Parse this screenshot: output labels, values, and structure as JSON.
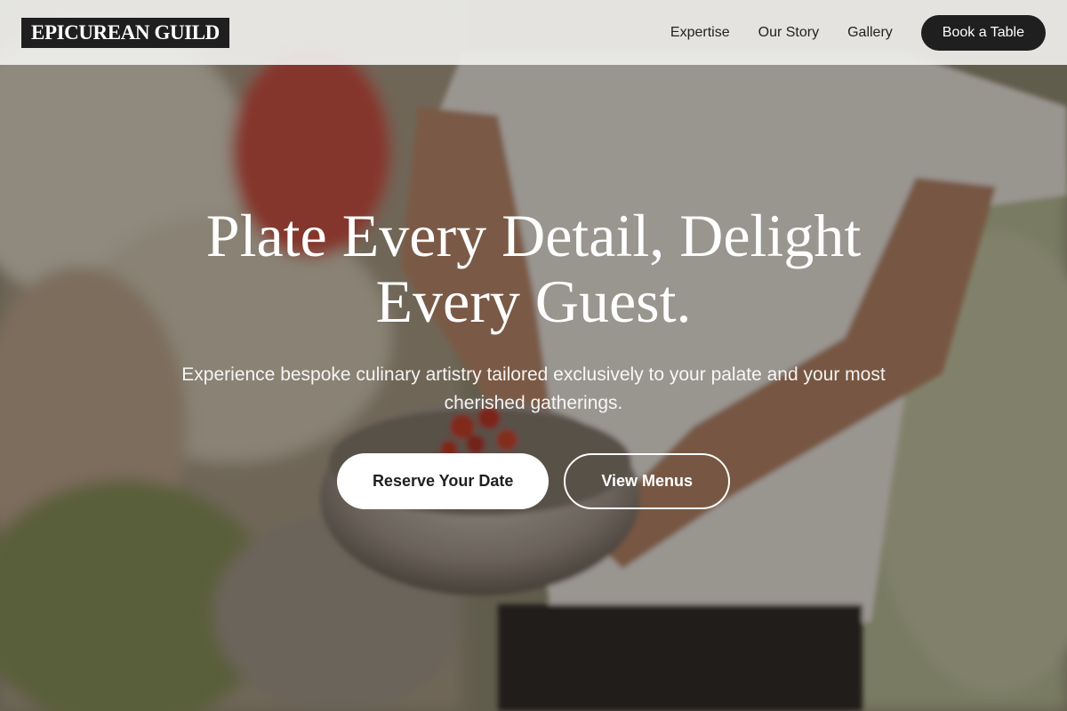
{
  "header": {
    "logo": "EPICUREAN GUILD",
    "nav": [
      {
        "label": "Expertise"
      },
      {
        "label": "Our Story"
      },
      {
        "label": "Gallery"
      }
    ],
    "cta_label": "Book a Table"
  },
  "hero": {
    "title": "Plate Every Detail, Delight Every Guest.",
    "subtitle": "Experience bespoke culinary artistry tailored exclusively to your palate and your most cherished gatherings.",
    "primary_cta": "Reserve Your Date",
    "secondary_cta": "View Menus",
    "background_image": "chef holding a metal bowl of cherry tomatoes in a garden"
  },
  "colors": {
    "header_bg": "#eeeeec",
    "dark": "#1f1f1f",
    "white": "#ffffff",
    "overlay": "#281e18"
  }
}
